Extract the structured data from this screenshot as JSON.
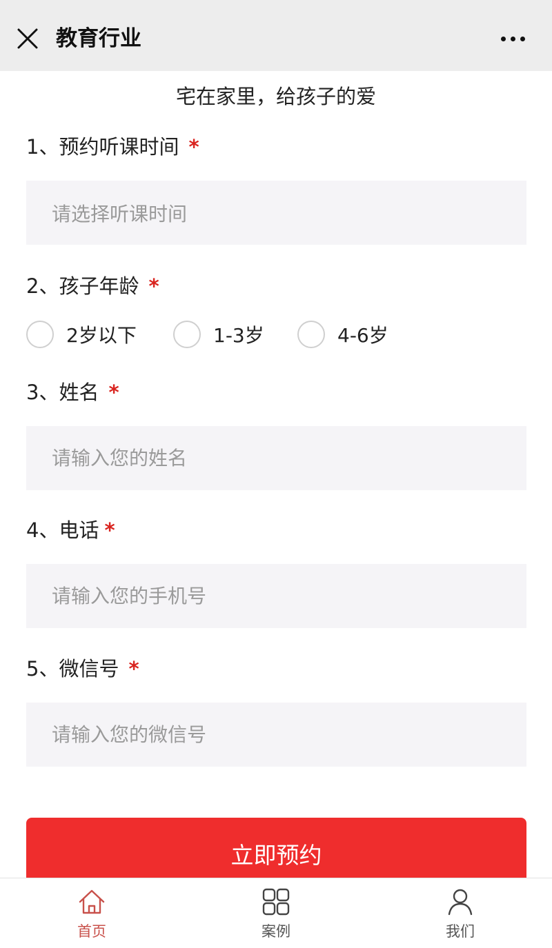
{
  "header": {
    "title": "教育行业"
  },
  "form": {
    "subtitle": "宅在家里，给孩子的爱",
    "required_mark": "*",
    "questions": [
      {
        "label": "1、预约听课时间",
        "placeholder": "请选择听课时间"
      },
      {
        "label": "2、孩子年龄",
        "options": [
          "2岁以下",
          "1-3岁",
          "4-6岁"
        ]
      },
      {
        "label": "3、姓名",
        "placeholder": "请输入您的姓名"
      },
      {
        "label": "4、电话",
        "placeholder": "请输入您的手机号"
      },
      {
        "label": "5、微信号",
        "placeholder": "请输入您的微信号"
      }
    ],
    "submit_label": "立即预约"
  },
  "tabbar": {
    "items": [
      {
        "label": "首页",
        "icon": "home-icon",
        "active": true
      },
      {
        "label": "案例",
        "icon": "grid-icon",
        "active": false
      },
      {
        "label": "我们",
        "icon": "user-icon",
        "active": false
      }
    ]
  },
  "colors": {
    "accent": "#ef2d2d",
    "required": "#d9241f",
    "active_tab": "#c8504a",
    "inactive_tab": "#555555",
    "header_bg": "#ededed",
    "input_bg": "#f5f4f7"
  }
}
